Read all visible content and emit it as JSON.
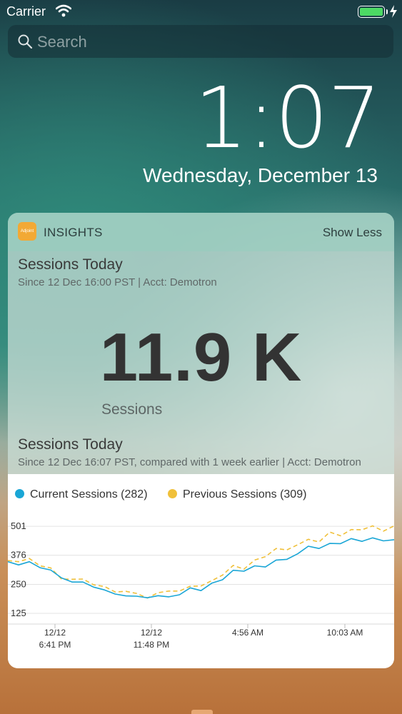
{
  "status_bar": {
    "carrier": "Carrier"
  },
  "search": {
    "placeholder": "Search"
  },
  "lockscreen": {
    "time": "1:07",
    "date": "Wednesday, December 13"
  },
  "widget": {
    "app_icon_text": "Adjoint",
    "app_name": "INSIGHTS",
    "show_less": "Show Less",
    "section1": {
      "title": "Sessions Today",
      "subtitle": "Since 12 Dec 16:00 PST | Acct: Demotron",
      "value": "11.9 K",
      "value_label": "Sessions"
    },
    "section2": {
      "title": "Sessions Today",
      "subtitle": "Since 12 Dec 16:07 PST, compared with 1 week earlier | Acct: Demotron"
    }
  },
  "colors": {
    "current": "#1aa6d6",
    "previous": "#f0c03a",
    "battery": "#4cd964"
  },
  "chart_data": {
    "type": "line",
    "legend": [
      "Current Sessions (282)",
      "Previous Sessions (309)"
    ],
    "y_ticks": [
      "501",
      "376",
      "250",
      "125"
    ],
    "y_tick_values": [
      501,
      376,
      250,
      125
    ],
    "ylim": [
      60,
      560
    ],
    "x_ticks": [
      {
        "line1": "12/12",
        "line2": "6:41 PM"
      },
      {
        "line1": "12/12",
        "line2": "11:48 PM"
      },
      {
        "line1": "4:56 AM",
        "line2": ""
      },
      {
        "line1": "10:03 AM",
        "line2": ""
      }
    ],
    "series": [
      {
        "name": "Current Sessions (282)",
        "style": "solid",
        "values": [
          348,
          334,
          348,
          322,
          312,
          278,
          260,
          260,
          238,
          226,
          208,
          200,
          199,
          192,
          201,
          196,
          205,
          235,
          223,
          255,
          270,
          311,
          307,
          330,
          325,
          355,
          358,
          382,
          415,
          405,
          427,
          426,
          448,
          436,
          451,
          438,
          443
        ]
      },
      {
        "name": "Previous Sessions (309)",
        "style": "dashed",
        "values": [
          353,
          348,
          362,
          330,
          321,
          273,
          272,
          273,
          248,
          241,
          217,
          220,
          211,
          191,
          214,
          221,
          221,
          242,
          243,
          266,
          290,
          332,
          316,
          355,
          370,
          405,
          399,
          421,
          445,
          433,
          476,
          460,
          487,
          486,
          503,
          480,
          503
        ]
      }
    ]
  }
}
